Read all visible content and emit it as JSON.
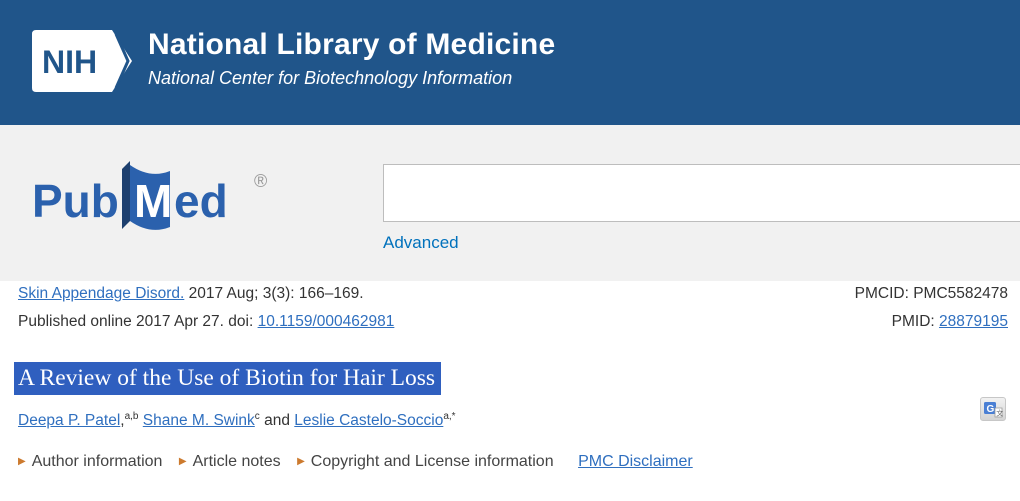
{
  "header": {
    "logo_text": "NIH",
    "title": "National Library of Medicine",
    "subtitle": "National Center for Biotechnology Information",
    "brand_color": "#20558a"
  },
  "search": {
    "logo_text": "PubMed",
    "logo_registered": "®",
    "value": "",
    "placeholder": "",
    "advanced_label": "Advanced"
  },
  "citation": {
    "journal": "Skin Appendage Disord.",
    "details": " 2017 Aug; 3(3): 166–169.",
    "published_prefix": "Published online 2017 Apr 27. doi: ",
    "doi": "10.1159/000462981",
    "pmcid_label": "PMCID: ",
    "pmcid": "PMC5582478",
    "pmid_label": "PMID: ",
    "pmid": "28879195"
  },
  "article": {
    "title": "A Review of the Use of Biotin for Hair Loss",
    "title_highlight_color": "#2f5fbf",
    "authors": [
      {
        "name": "Deepa P. Patel",
        "sup": "a,b",
        "after": ","
      },
      {
        "name": "Shane M. Swink",
        "sup": "c",
        "after": ""
      },
      {
        "name": "Leslie Castelo-Soccio",
        "sup": "a,*",
        "after": ""
      }
    ],
    "and_word": " and "
  },
  "info_links": {
    "author_information": "Author information",
    "article_notes": "Article notes",
    "copyright": "Copyright and License information",
    "disclaimer": "PMC Disclaimer"
  }
}
